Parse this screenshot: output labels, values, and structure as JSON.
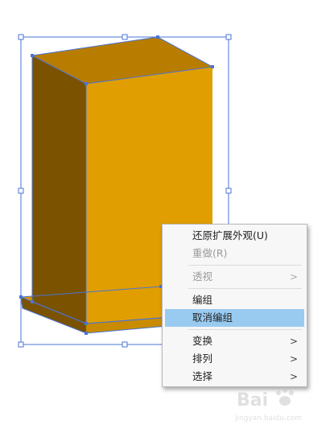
{
  "context_menu": {
    "items": [
      {
        "label": "还原扩展外观(U)",
        "enabled": true,
        "submenu": false
      },
      {
        "label": "重做(R)",
        "enabled": false,
        "submenu": false
      },
      {
        "label": "透视",
        "enabled": false,
        "submenu": true
      },
      {
        "label": "编组",
        "enabled": true,
        "submenu": false
      },
      {
        "label": "取消编组",
        "enabled": true,
        "submenu": false,
        "highlighted": true
      },
      {
        "label": "变换",
        "enabled": true,
        "submenu": true
      },
      {
        "label": "排列",
        "enabled": true,
        "submenu": true
      },
      {
        "label": "选择",
        "enabled": true,
        "submenu": true
      }
    ],
    "submenu_arrow": ">",
    "highlight_color": "#99cbf1"
  },
  "artwork": {
    "front_color": "#e09e00",
    "side_color": "#7a5200",
    "top_color": "#b87d00",
    "selection_color": "#4a74d6"
  },
  "watermark": {
    "brand": "Bai",
    "sub": "jingyan.baidu.com"
  }
}
